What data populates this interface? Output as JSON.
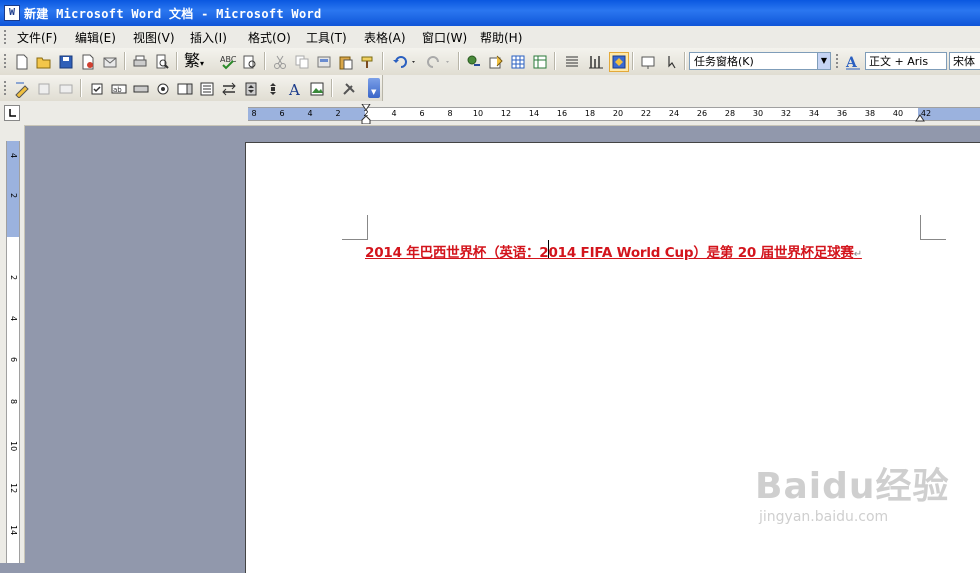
{
  "window": {
    "title": "新建 Microsoft Word 文档 - Microsoft Word",
    "app_icon": "W"
  },
  "menu": {
    "items": [
      {
        "label": "文件(F)"
      },
      {
        "label": "编辑(E)"
      },
      {
        "label": "视图(V)"
      },
      {
        "label": "插入(I)"
      },
      {
        "label": "格式(O)"
      },
      {
        "label": "工具(T)"
      },
      {
        "label": "表格(A)"
      },
      {
        "label": "窗口(W)"
      },
      {
        "label": "帮助(H)"
      }
    ]
  },
  "toolbar": {
    "traditional_label": "繁",
    "task_pane_label": "任务窗格(K)",
    "style_value": "正文 + Aris",
    "font_value": "宋体"
  },
  "ruler": {
    "horizontal_ticks": [
      "8",
      "6",
      "4",
      "2",
      "2",
      "4",
      "6",
      "8",
      "10",
      "12",
      "14",
      "16",
      "18",
      "20",
      "22",
      "24",
      "26",
      "28",
      "30",
      "32",
      "34",
      "36",
      "38",
      "40",
      "42"
    ],
    "vertical_ticks": [
      "4",
      "2",
      "2",
      "4",
      "6",
      "8",
      "10",
      "12",
      "14"
    ]
  },
  "document": {
    "text": "2014 年巴西世界杯（英语：2014 FIFA World Cup）是第 20 届世界杯足球赛",
    "paragraph_mark": "↵",
    "text_color": "#d3141c"
  },
  "watermark": {
    "brand": "Baidu经验",
    "url": "jingyan.baidu.com"
  }
}
